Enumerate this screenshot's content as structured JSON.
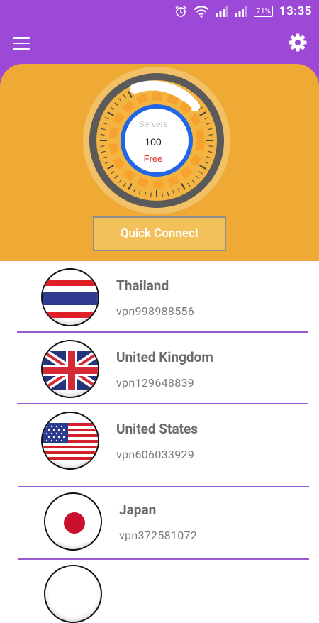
{
  "status_bar": {
    "battery": "71%",
    "time": "13:35"
  },
  "dashboard": {
    "servers_label": "Servers",
    "servers_count": "100",
    "servers_tier": "Free",
    "quick_connect_label": "Quick Connect"
  },
  "servers": [
    {
      "country": "Thailand",
      "code": "vpn998988556",
      "flag": "thailand-flag"
    },
    {
      "country": "United Kingdom",
      "code": "vpn129648839",
      "flag": "united-kingdom-flag"
    },
    {
      "country": "United States",
      "code": "vpn606033929",
      "flag": "united-states-flag"
    },
    {
      "country": "Japan",
      "code": "vpn372581072",
      "flag": "japan-flag"
    }
  ],
  "colors": {
    "app_bar": "#9b49d6",
    "hero_background": "#eeaa35",
    "divider": "#9b59d0",
    "free_text": "#e32a2a"
  }
}
